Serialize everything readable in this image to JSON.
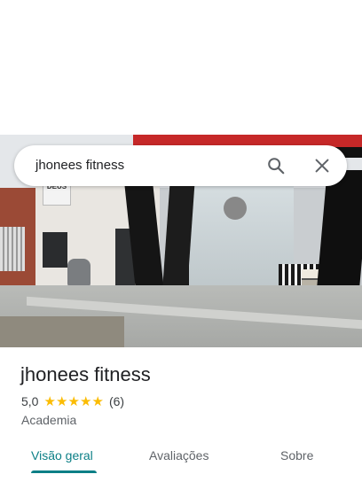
{
  "search": {
    "query": "jhonees fitness"
  },
  "photo": {
    "sign_text": "DEUS"
  },
  "place": {
    "name": "jhonees fitness",
    "rating": "5,0",
    "stars": 5,
    "review_count": "(6)",
    "category": "Academia"
  },
  "tabs": [
    {
      "label": "Visão geral",
      "selected": true
    },
    {
      "label": "Avaliações",
      "selected": false
    },
    {
      "label": "Sobre",
      "selected": false
    }
  ],
  "colors": {
    "accent": "#0b7f86",
    "star": "#fbbc04"
  },
  "icons": {
    "search": "search-icon",
    "close": "close-icon",
    "star": "star-icon"
  }
}
